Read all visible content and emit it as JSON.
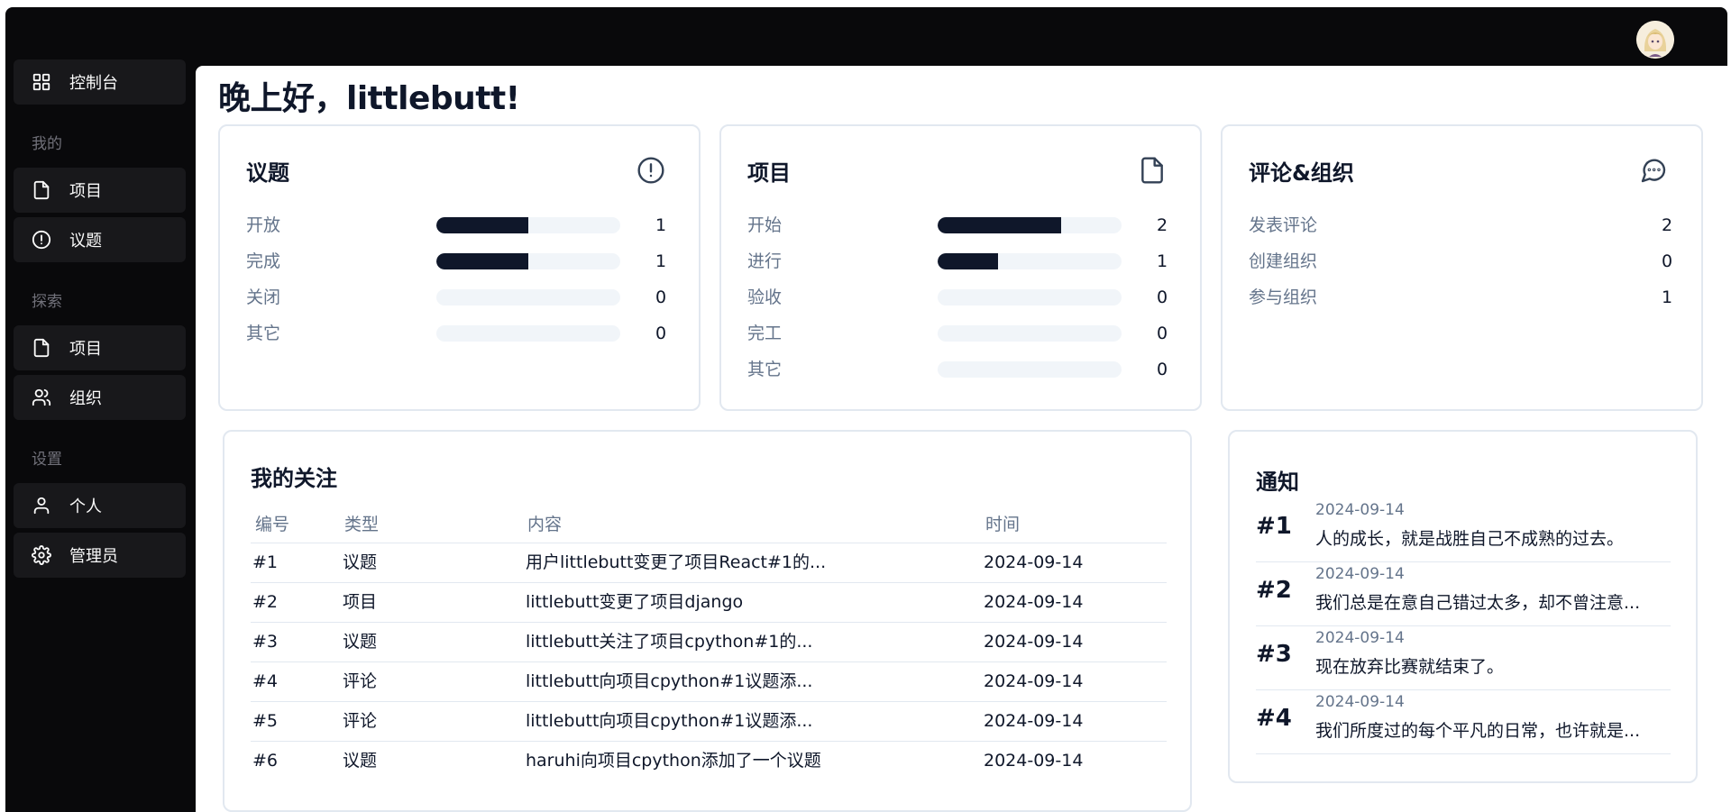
{
  "header": {
    "avatar_label": "user avatar"
  },
  "sidebar": {
    "dashboard": "控制台",
    "sections": [
      {
        "label": "我的",
        "items": [
          "项目",
          "议题"
        ]
      },
      {
        "label": "探索",
        "items": [
          "项目",
          "组织"
        ]
      },
      {
        "label": "设置",
        "items": [
          "个人",
          "管理员"
        ]
      }
    ]
  },
  "greeting": "晚上好，littlebutt!",
  "cards": {
    "issues": {
      "title": "议题",
      "icon": "alert-circle-icon",
      "rows": [
        {
          "label": "开放",
          "value": "1",
          "fill": 0.5
        },
        {
          "label": "完成",
          "value": "1",
          "fill": 0.5
        },
        {
          "label": "关闭",
          "value": "0",
          "fill": 0
        },
        {
          "label": "其它",
          "value": "0",
          "fill": 0
        }
      ]
    },
    "projects": {
      "title": "项目",
      "icon": "file-icon",
      "rows": [
        {
          "label": "开始",
          "value": "2",
          "fill": 0.67
        },
        {
          "label": "进行",
          "value": "1",
          "fill": 0.33
        },
        {
          "label": "验收",
          "value": "0",
          "fill": 0
        },
        {
          "label": "完工",
          "value": "0",
          "fill": 0
        },
        {
          "label": "其它",
          "value": "0",
          "fill": 0
        }
      ]
    },
    "social": {
      "title": "评论&组织",
      "icon": "message-circle-icon",
      "rows": [
        {
          "label": "发表评论",
          "value": "2"
        },
        {
          "label": "创建组织",
          "value": "0"
        },
        {
          "label": "参与组织",
          "value": "1"
        }
      ]
    }
  },
  "watching": {
    "title": "我的关注",
    "headers": [
      "编号",
      "类型",
      "内容",
      "时间"
    ],
    "rows": [
      [
        "#1",
        "议题",
        "用户littlebutt变更了项目React#1的...",
        "2024-09-14"
      ],
      [
        "#2",
        "项目",
        "littlebutt变更了项目django",
        "2024-09-14"
      ],
      [
        "#3",
        "议题",
        "littlebutt关注了项目cpython#1的...",
        "2024-09-14"
      ],
      [
        "#4",
        "评论",
        "littlebutt向项目cpython#1议题添...",
        "2024-09-14"
      ],
      [
        "#5",
        "评论",
        "littlebutt向项目cpython#1议题添...",
        "2024-09-14"
      ],
      [
        "#6",
        "议题",
        "haruhi向项目cpython添加了一个议题",
        "2024-09-14"
      ]
    ]
  },
  "notices": {
    "title": "通知",
    "items": [
      {
        "num": "#1",
        "date": "2024-09-14",
        "text": "人的成长，就是战胜自己不成熟的过去。"
      },
      {
        "num": "#2",
        "date": "2024-09-14",
        "text": "我们总是在意自己错过太多，却不曾注意..."
      },
      {
        "num": "#3",
        "date": "2024-09-14",
        "text": "现在放弃比赛就结束了。"
      },
      {
        "num": "#4",
        "date": "2024-09-14",
        "text": "我们所度过的每个平凡的日常，也许就是..."
      }
    ]
  }
}
